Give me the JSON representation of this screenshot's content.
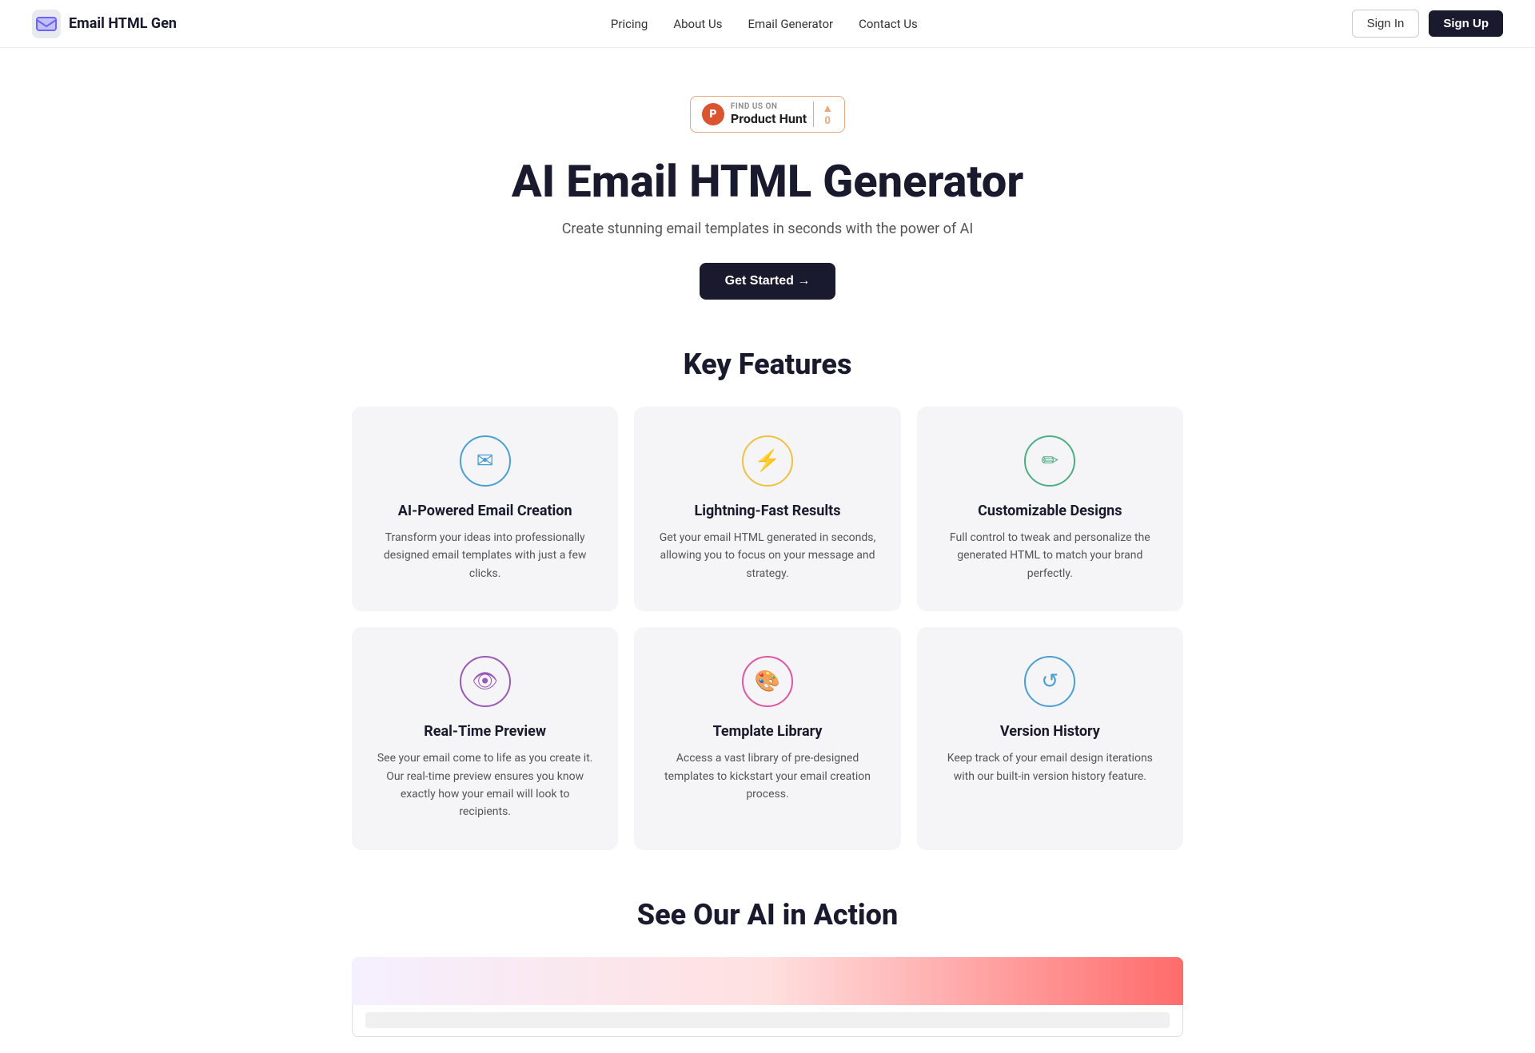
{
  "navbar": {
    "logo_text": "Email HTML Gen",
    "links": [
      {
        "label": "Pricing",
        "href": "#"
      },
      {
        "label": "About Us",
        "href": "#"
      },
      {
        "label": "Email Generator",
        "href": "#"
      },
      {
        "label": "Contact Us",
        "href": "#"
      }
    ],
    "signin_label": "Sign In",
    "signup_label": "Sign Up"
  },
  "product_hunt": {
    "find_text": "FIND US ON",
    "name": "Product Hunt",
    "p_letter": "P",
    "vote_count": "0"
  },
  "hero": {
    "title": "AI Email HTML Generator",
    "subtitle": "Create stunning email templates in seconds with the power of AI",
    "cta_label": "Get Started →"
  },
  "features_section": {
    "title": "Key Features",
    "cards": [
      {
        "icon": "✉",
        "icon_class": "icon-blue",
        "title": "AI-Powered Email Creation",
        "description": "Transform your ideas into professionally designed email templates with just a few clicks."
      },
      {
        "icon": "⚡",
        "icon_class": "icon-yellow",
        "title": "Lightning-Fast Results",
        "description": "Get your email HTML generated in seconds, allowing you to focus on your message and strategy."
      },
      {
        "icon": "✏",
        "icon_class": "icon-green",
        "title": "Customizable Designs",
        "description": "Full control to tweak and personalize the generated HTML to match your brand perfectly."
      },
      {
        "icon": "👁",
        "icon_class": "icon-purple",
        "title": "Real-Time Preview",
        "description": "See your email come to life as you create it. Our real-time preview ensures you know exactly how your email will look to recipients."
      },
      {
        "icon": "🎨",
        "icon_class": "icon-pink",
        "title": "Template Library",
        "description": "Access a vast library of pre-designed templates to kickstart your email creation process."
      },
      {
        "icon": "↺",
        "icon_class": "icon-teal",
        "title": "Version History",
        "description": "Keep track of your email design iterations with our built-in version history feature."
      }
    ]
  },
  "action_section": {
    "title": "See Our AI in Action"
  }
}
